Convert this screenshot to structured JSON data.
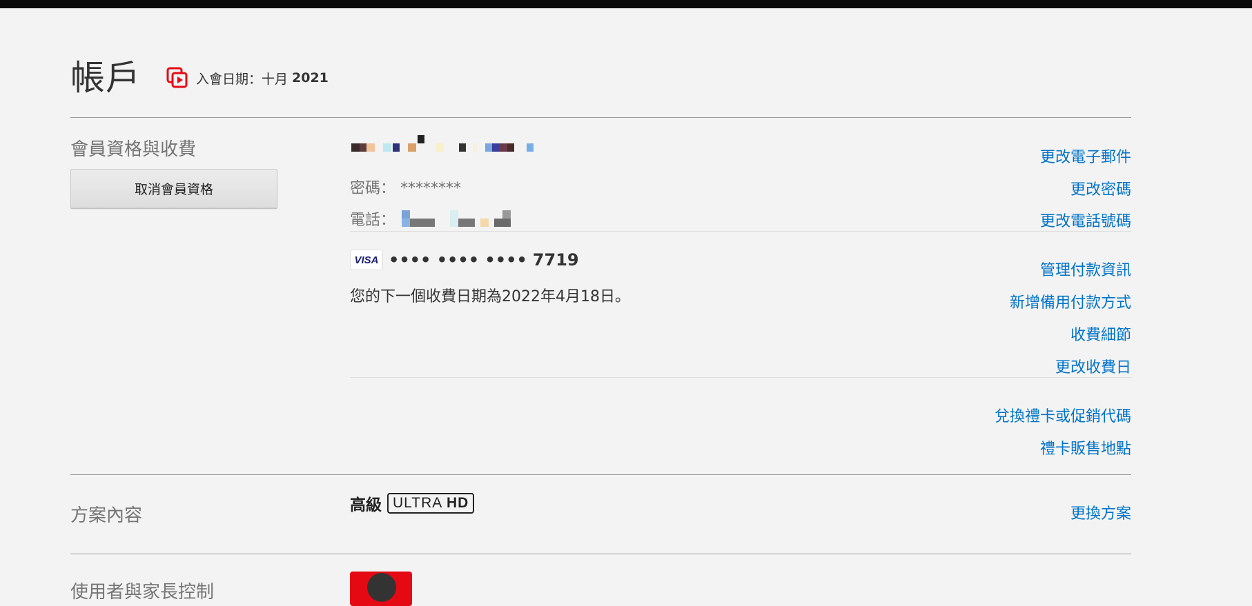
{
  "header": {
    "title": "帳戶",
    "member_since_label": "入會日期：十月",
    "member_since_year": "2021"
  },
  "membership": {
    "section_title": "會員資格與收費",
    "cancel_button": "取消會員資格",
    "password_label": "密碼：",
    "password_value": "********",
    "phone_label": "電話：",
    "links": {
      "change_email": "更改電子郵件",
      "change_password": "更改密碼",
      "change_phone": "更改電話號碼",
      "manage_payment": "管理付款資訊",
      "add_backup_payment": "新增備用付款方式",
      "billing_details": "收費細節",
      "change_billing_day": "更改收費日",
      "redeem_gift_card": "兌換禮卡或促銷代碼",
      "gift_card_retailers": "禮卡販售地點"
    },
    "card": {
      "brand": "VISA",
      "masked": "•••• •••• ••••",
      "last4": "7719"
    },
    "next_billing": "您的下一個收費日期為2022年4月18日。"
  },
  "plan": {
    "section_title": "方案內容",
    "name": "高級",
    "badge_light": "ULTRA",
    "badge_bold": "HD",
    "change_plan": "更換方案"
  },
  "profiles": {
    "section_title": "使用者與家長控制"
  },
  "colors": {
    "link": "#0073c8",
    "accent": "#e50914",
    "background": "#f3f3f3"
  }
}
